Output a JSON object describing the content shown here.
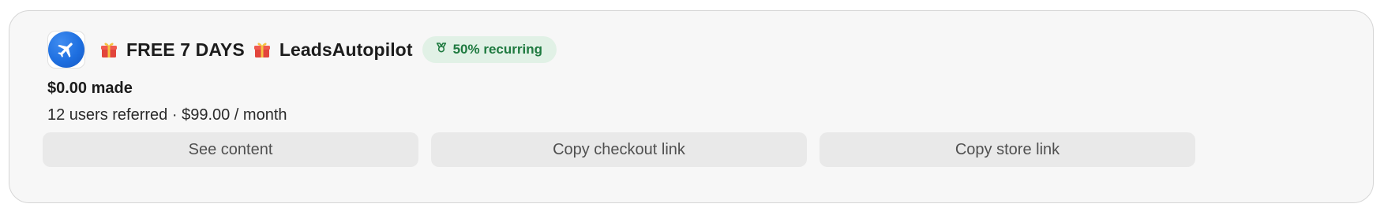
{
  "card": {
    "title_prefix": "FREE 7 DAYS",
    "title_name": "LeadsAutopilot",
    "gift_icon": "gift-icon",
    "logo_icon": "airplane-icon",
    "badge": {
      "text": "50% recurring",
      "icon": "ribbon-icon",
      "color": "#1f7a40",
      "background": "#e1f1e6"
    },
    "earnings": "$0.00 made",
    "stats": "12 users referred · $99.00 / month"
  },
  "actions": {
    "see_content": "See content",
    "copy_checkout": "Copy checkout link",
    "copy_store": "Copy store link"
  },
  "colors": {
    "card_background": "#f7f7f7",
    "button_background": "#e9e9e9",
    "logo_blue": "#1e6fe0"
  }
}
